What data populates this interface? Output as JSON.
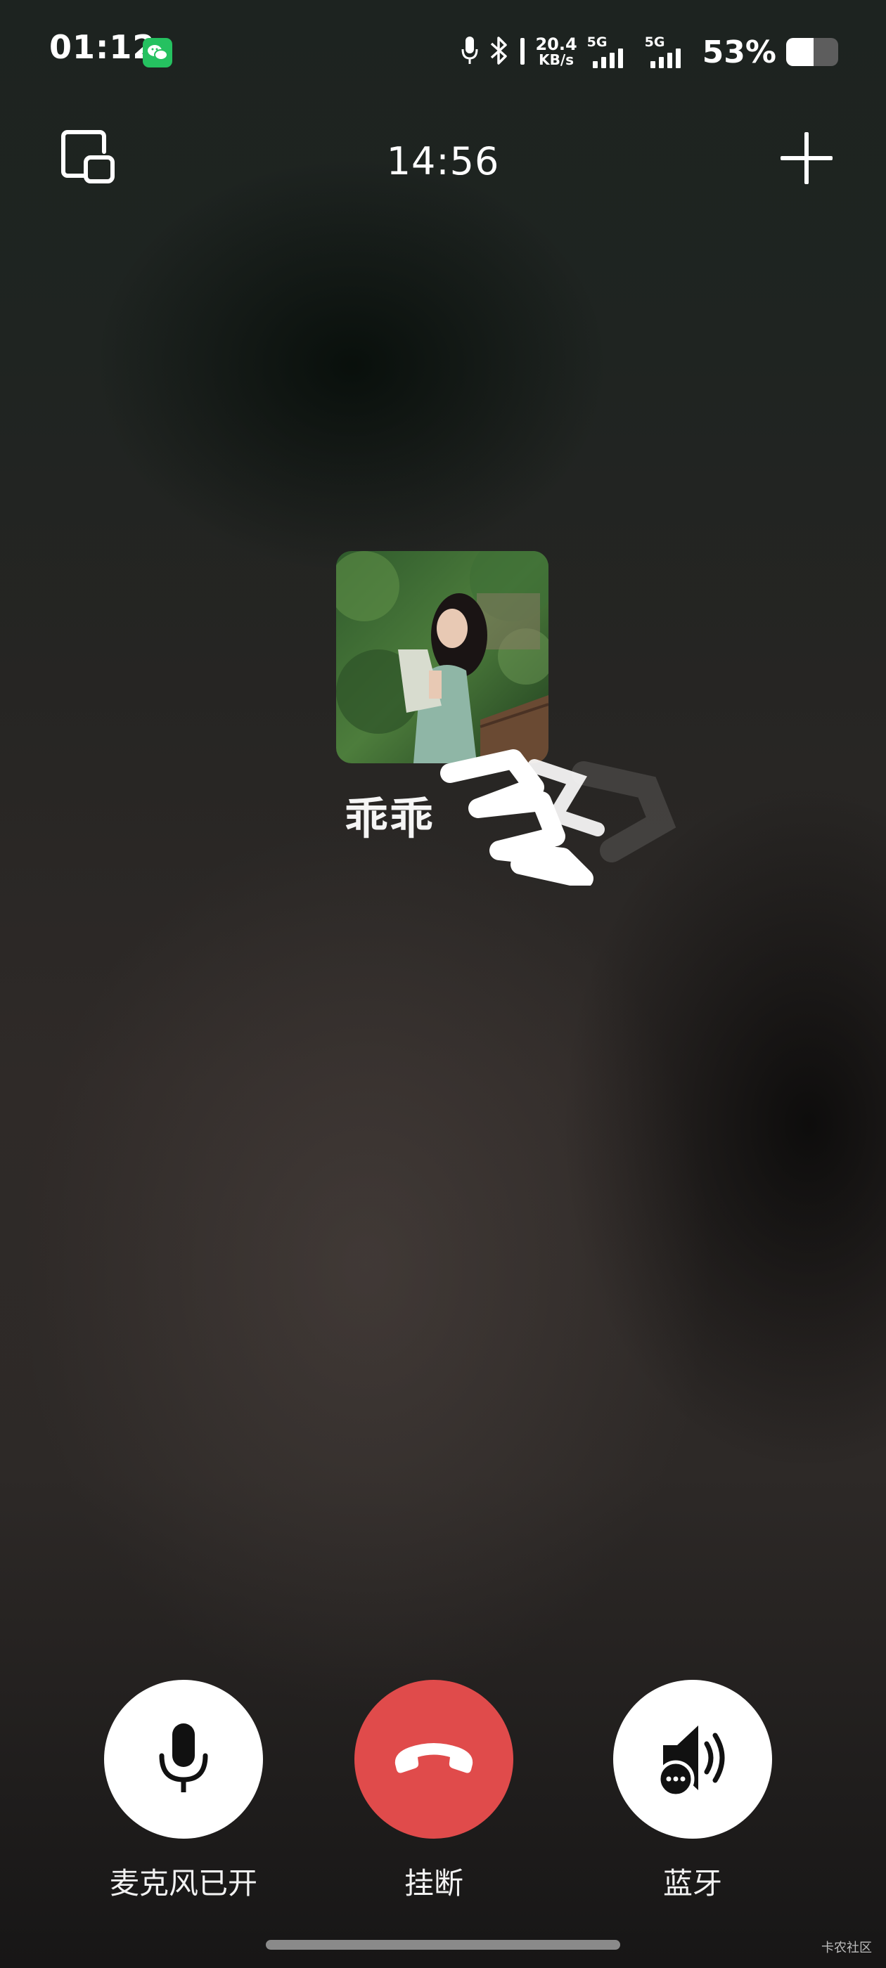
{
  "status_bar": {
    "time": "01:12",
    "notification_icon": "wechat-icon",
    "icons": [
      "microphone-icon",
      "bluetooth-icon"
    ],
    "net_speed_value": "20.4",
    "net_speed_unit": "KB/s",
    "sim1_label": "5G",
    "sim2_label": "5G",
    "battery_percent": "53%",
    "battery_level": 0.53
  },
  "header": {
    "minimize_icon": "minimize-window-icon",
    "call_duration": "14:56",
    "add_icon": "plus-icon"
  },
  "contact": {
    "name": "乖乖",
    "avatar": "photo-avatar"
  },
  "controls": {
    "microphone_label": "麦克风已开",
    "hangup_label": "挂断",
    "bluetooth_label": "蓝牙",
    "colors": {
      "hangup": "#e04b4b",
      "button_bg": "#ffffff",
      "icon": "#1a1a1a"
    }
  },
  "watermark": "卡农社区"
}
